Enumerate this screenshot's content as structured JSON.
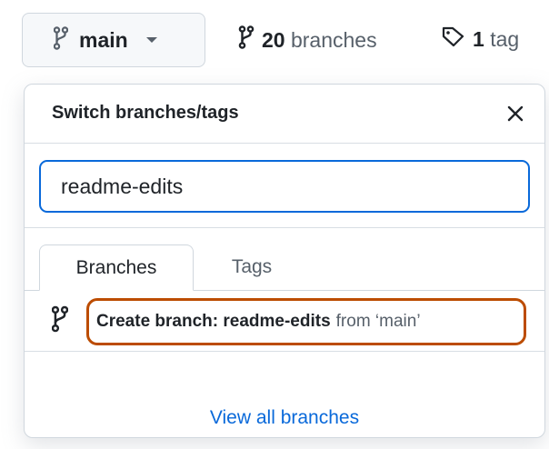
{
  "topbar": {
    "branch_button_label": "main",
    "branches_count": "20",
    "branches_label": "branches",
    "tags_count": "1",
    "tags_label": "tag"
  },
  "panel": {
    "title": "Switch branches/tags",
    "filter_value": "readme-edits",
    "tabs": [
      {
        "label": "Branches",
        "active": true
      },
      {
        "label": "Tags",
        "active": false
      }
    ],
    "create_prefix": "Create branch: readme-edits",
    "create_suffix": "from ‘main’",
    "view_all_label": "View all branches"
  },
  "colors": {
    "accent": "#0969da",
    "highlight_outline": "#bc4c00",
    "muted_text": "#57606a",
    "border": "#d0d7de"
  },
  "icons": [
    "git-branch-icon",
    "tag-icon",
    "close-icon",
    "caret-down-icon"
  ]
}
